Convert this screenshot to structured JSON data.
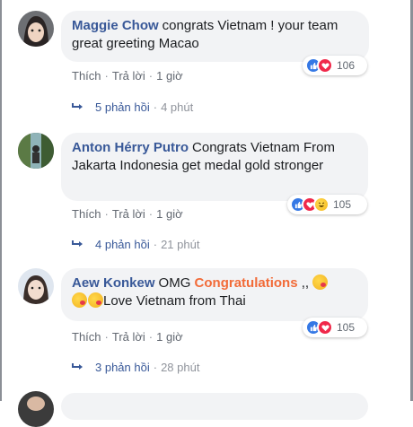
{
  "colors": {
    "name_blue": "#385898",
    "bubble_bg": "#f2f3f5",
    "highlight": "#f26b38",
    "meta_gray": "#90949c"
  },
  "comments": [
    {
      "author": "Maggie Chow",
      "text": "congrats Vietnam ! your team great greeting Macao",
      "text_line2": "",
      "reactions": [
        "like-icon",
        "love-icon"
      ],
      "reaction_count": "106",
      "actions": {
        "like": "Thích",
        "reply": "Trả lời",
        "time": "1 giờ"
      },
      "replies": {
        "count_label": "5 phản hồi",
        "time": "4 phút"
      }
    },
    {
      "author": "Anton Hérry Putro",
      "text": "Congrats Vietnam From Jakarta Indonesia get medal gold stronger",
      "reactions": [
        "like-icon",
        "love-icon",
        "haha-icon"
      ],
      "reaction_count": "105",
      "actions": {
        "like": "Thích",
        "reply": "Trả lời",
        "time": "1 giờ"
      },
      "replies": {
        "count_label": "4 phản hồi",
        "time": "21 phút"
      }
    },
    {
      "author": "Aew Konkew",
      "text_a": "OMG",
      "text_highlight": "Congratulations",
      "text_b": ",,",
      "text_c": "Love Vietnam from Thai",
      "reactions": [
        "like-icon",
        "love-icon"
      ],
      "reaction_count": "105",
      "actions": {
        "like": "Thích",
        "reply": "Trả lời",
        "time": "1 giờ"
      },
      "replies": {
        "count_label": "3 phản hồi",
        "time": "28 phút"
      }
    }
  ]
}
